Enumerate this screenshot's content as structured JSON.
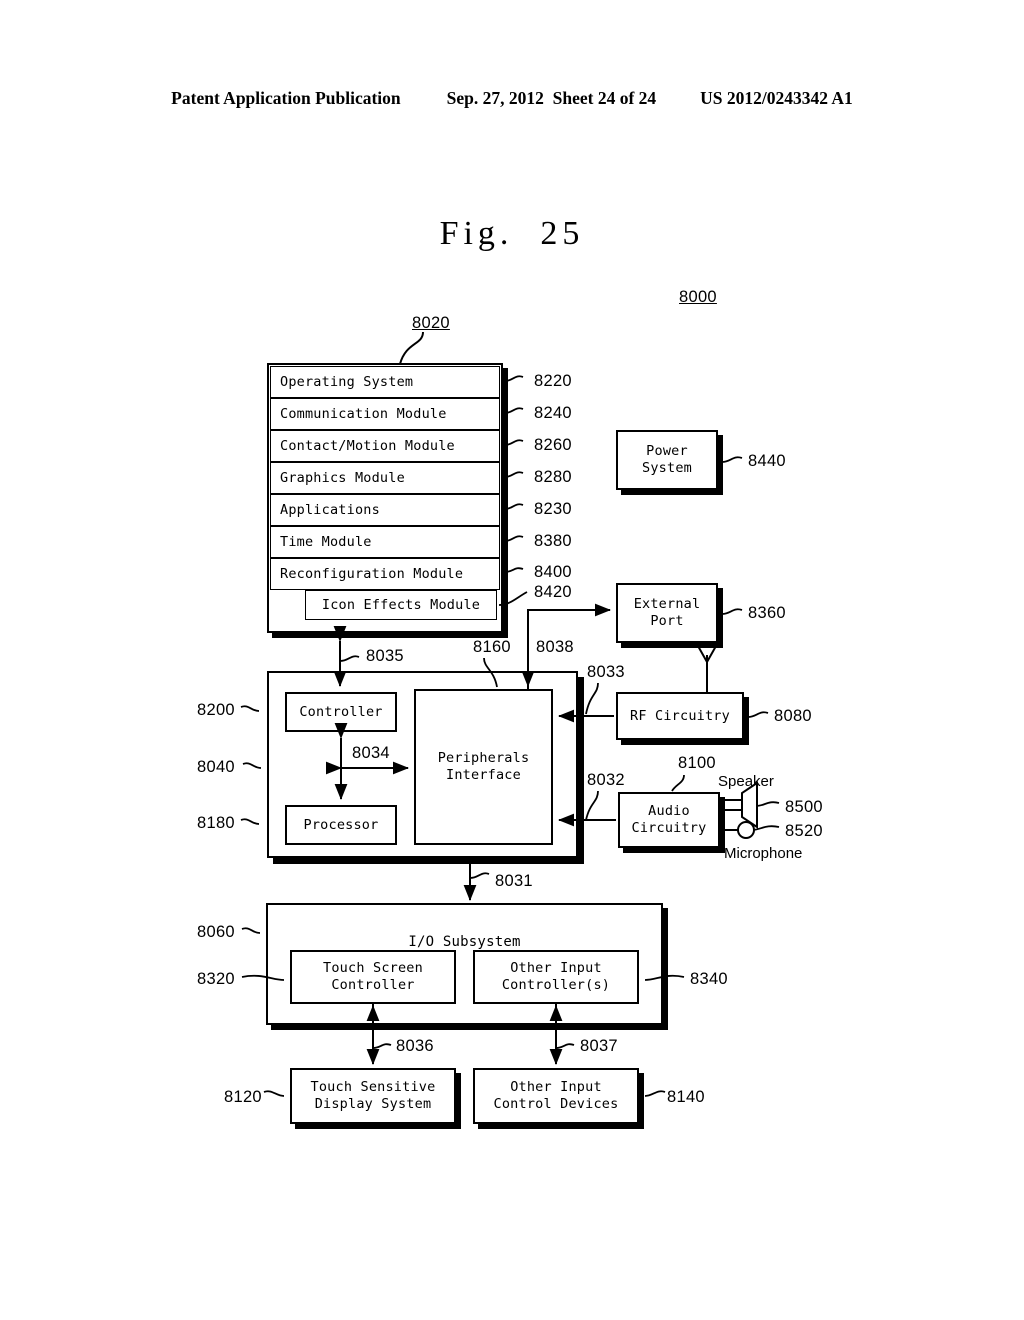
{
  "header": {
    "publication": "Patent Application Publication",
    "date": "Sep. 27, 2012",
    "sheet": "Sheet 24 of 24",
    "docnum": "US 2012/0243342 A1"
  },
  "figure": {
    "label": "Fig.",
    "number": "25",
    "system_ref": "8000"
  },
  "memory": {
    "ref": "8020",
    "rows": [
      {
        "label": "Operating System",
        "ref": "8220"
      },
      {
        "label": "Communication Module",
        "ref": "8240"
      },
      {
        "label": "Contact/Motion Module",
        "ref": "8260"
      },
      {
        "label": "Graphics Module",
        "ref": "8280"
      },
      {
        "label": "Applications",
        "ref": "8230"
      },
      {
        "label": "Time Module",
        "ref": "8380"
      },
      {
        "label": "Reconfiguration Module",
        "ref": "8400"
      }
    ],
    "sub": {
      "label": "Icon Effects Module",
      "ref": "8420"
    }
  },
  "blocks": {
    "power_system": {
      "label": "Power\nSystem",
      "ref": "8440"
    },
    "external_port": {
      "label": "External\nPort",
      "ref": "8360"
    },
    "rf_circuitry": {
      "label": "RF Circuitry",
      "ref": "8080"
    },
    "audio_circuitry": {
      "label": "Audio\nCircuitry",
      "ref": "8100"
    },
    "cpu_group": {
      "ref": "8040"
    },
    "controller": {
      "label": "Controller",
      "ref": "8200"
    },
    "processor": {
      "label": "Processor",
      "ref": "8180"
    },
    "peripherals": {
      "label": "Peripherals\nInterface",
      "ref": "8160"
    },
    "io_subsystem": {
      "label": "I/O Subsystem",
      "ref": "8060"
    },
    "touch_ctrl": {
      "label": "Touch Screen\nController",
      "ref": "8320"
    },
    "other_input_ctrl": {
      "label": "Other Input\nController(s)",
      "ref": "8340"
    },
    "touch_display": {
      "label": "Touch Sensitive\nDisplay System",
      "ref": "8120"
    },
    "other_devices": {
      "label": "Other Input\nControl Devices",
      "ref": "8140"
    }
  },
  "peripherals_io": {
    "speaker": {
      "label": "Speaker",
      "ref": "8500"
    },
    "microphone": {
      "label": "Microphone",
      "ref": "8520"
    }
  },
  "connections": {
    "memory_to_controller": "8035",
    "controller_to_peripherals": "8034",
    "peripherals_to_external_port": "8038",
    "rf_to_peripherals": "8033",
    "audio_to_peripherals": "8032",
    "peripherals_to_io": "8031",
    "touchctrl_to_display": "8036",
    "otherctrl_to_devices": "8037"
  }
}
